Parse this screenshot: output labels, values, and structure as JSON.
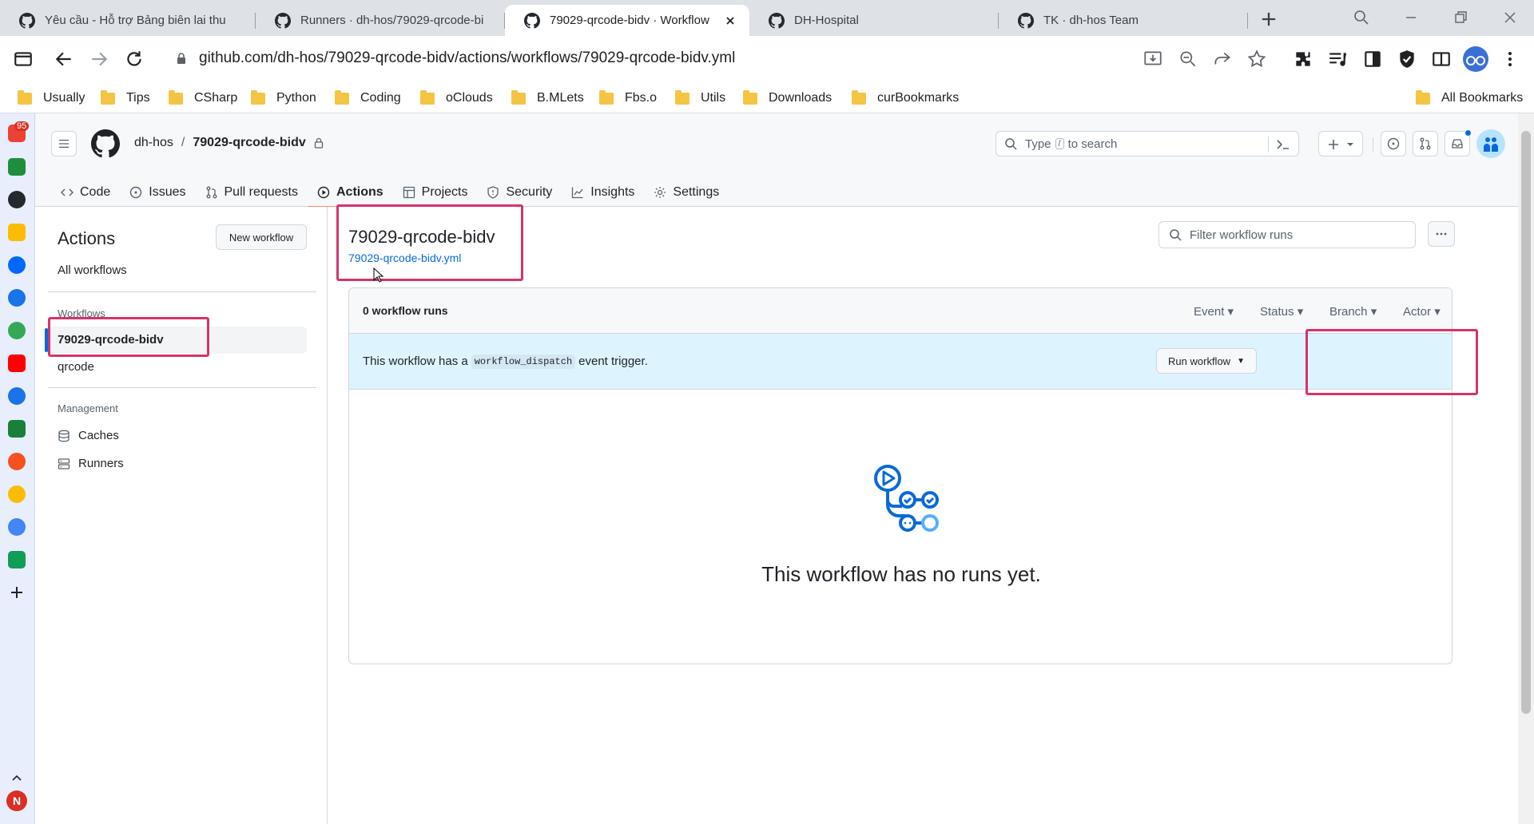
{
  "browser": {
    "tabs": [
      {
        "title": "Yêu cầu - Hỗ trợ Bảng biên lai thu",
        "active": false
      },
      {
        "title": "Runners · dh-hos/79029-qrcode-bi",
        "active": false
      },
      {
        "title": "79029-qrcode-bidv · Workflow",
        "active": true
      },
      {
        "title": "DH-Hospital",
        "active": false
      },
      {
        "title": "TK · dh-hos Team",
        "active": false
      }
    ],
    "url": "github.com/dh-hos/79029-qrcode-bidv/actions/workflows/79029-qrcode-bidv.yml",
    "bookmarks": [
      "Usually",
      "Tips",
      "CSharp",
      "Python",
      "Coding",
      "oClouds",
      "B.MLets",
      "Fbs.o",
      "Utils",
      "Downloads",
      "curBookmarks"
    ],
    "all_bookmarks": "All Bookmarks",
    "rail_badge": "95",
    "rail_avatar": "N"
  },
  "github": {
    "owner": "dh-hos",
    "separator": "/",
    "repo": "79029-qrcode-bidv",
    "search_placeholder_pre": "Type",
    "search_key": "/",
    "search_placeholder_post": "to search",
    "nav": [
      "Code",
      "Issues",
      "Pull requests",
      "Actions",
      "Projects",
      "Security",
      "Insights",
      "Settings"
    ],
    "active_nav": "Actions"
  },
  "sidebar": {
    "title": "Actions",
    "new_workflow": "New workflow",
    "all_workflows": "All workflows",
    "workflows_header": "Workflows",
    "workflows": [
      "79029-qrcode-bidv",
      "qrcode"
    ],
    "management_header": "Management",
    "management": [
      "Caches",
      "Runners"
    ]
  },
  "main": {
    "title": "79029-qrcode-bidv",
    "file": "79029-qrcode-bidv.yml",
    "filter_placeholder": "Filter workflow runs",
    "runs_count": "0 workflow runs",
    "filters": [
      "Event",
      "Status",
      "Branch",
      "Actor"
    ],
    "dispatch_pre": "This workflow has a",
    "dispatch_code": "workflow_dispatch",
    "dispatch_post": "event trigger.",
    "run_button": "Run workflow",
    "empty_text": "This workflow has no runs yet."
  },
  "colors": {
    "accent": "#0969da",
    "highlight": "#d6336c",
    "dispatch_bg": "#ddf4ff",
    "active_underline": "#fd8c73"
  }
}
